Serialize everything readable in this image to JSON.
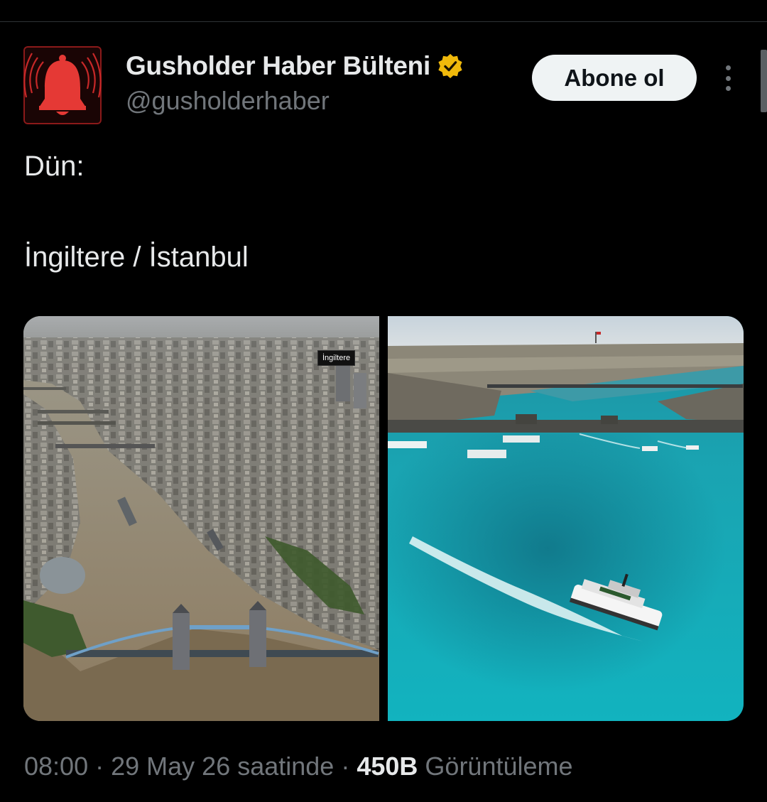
{
  "author": {
    "name": "Gusholder Haber Bülteni",
    "handle": "@gusholderhaber",
    "avatar_icon": "alarm-bell-icon",
    "verified_icon": "verified-badge-icon",
    "verified_color": "#f0b90b"
  },
  "actions": {
    "subscribe_label": "Abone ol",
    "more_icon": "more-vertical-icon"
  },
  "tweet": {
    "line1": "Dün:",
    "line2": "İngiltere / İstanbul"
  },
  "media": {
    "left_label": "İngiltere"
  },
  "meta": {
    "time": "08:00",
    "date": "29 May 26 saatinde",
    "views_count": "450B",
    "views_label": "Görüntüleme"
  },
  "colors": {
    "background": "#000000",
    "text": "#e7e9ea",
    "secondary": "#71767b",
    "avatar_red": "#e53935"
  }
}
